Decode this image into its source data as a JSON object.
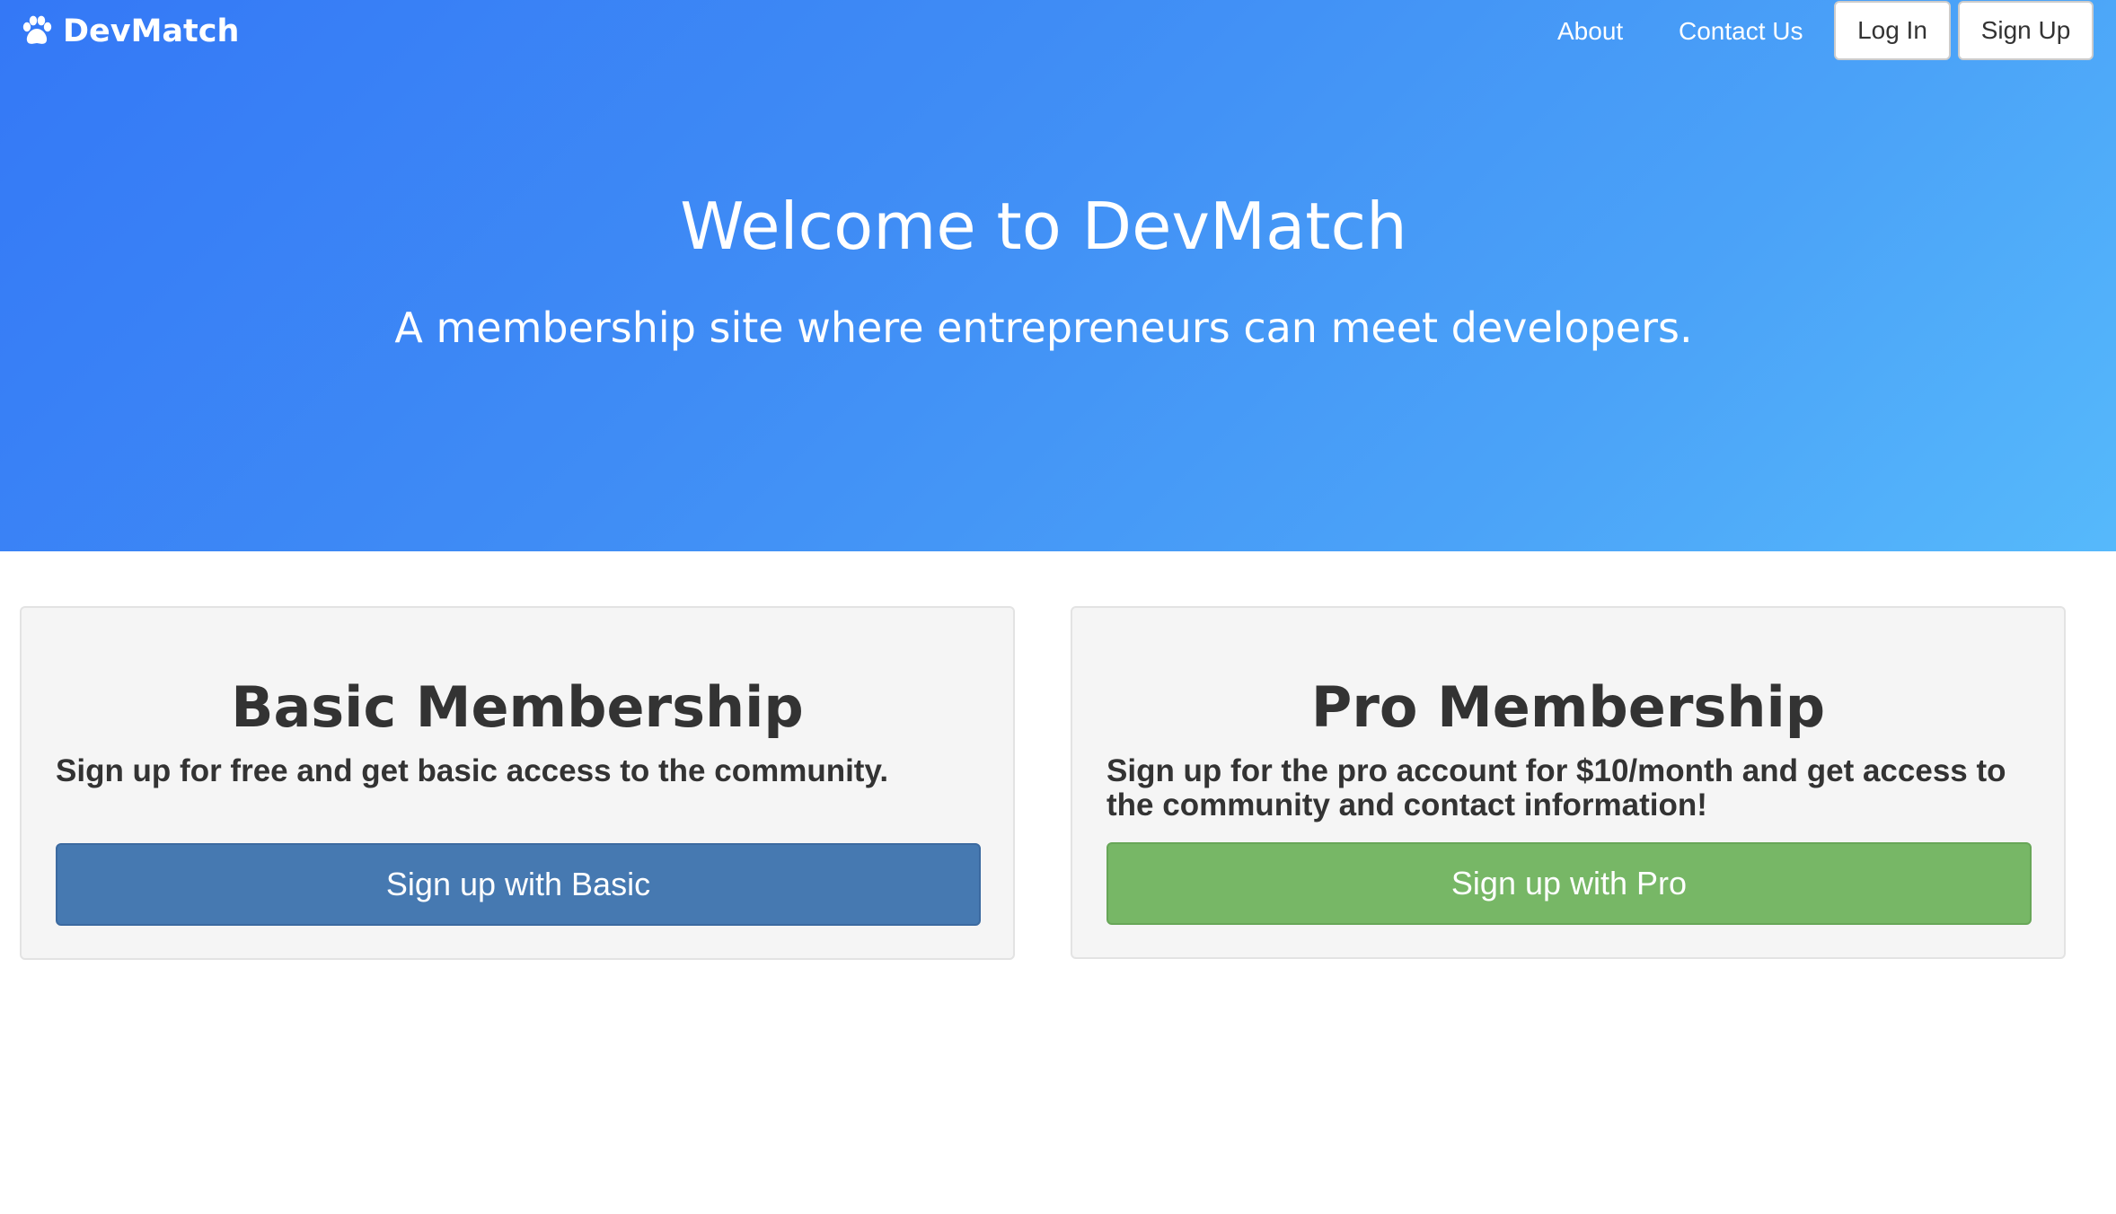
{
  "navbar": {
    "brand": {
      "icon": "paw-icon",
      "name": "DevMatch"
    },
    "links": {
      "about": "About",
      "contact": "Contact Us"
    },
    "buttons": {
      "login": "Log In",
      "signup": "Sign Up"
    }
  },
  "hero": {
    "title": "Welcome to DevMatch",
    "subtitle": "A membership site where entrepreneurs can meet developers.",
    "gradient": [
      "#3478f6",
      "#56b9fb"
    ]
  },
  "plans": {
    "basic": {
      "title": "Basic Membership",
      "description": "Sign up for free and get basic access to the community.",
      "button": "Sign up with Basic",
      "button_color": "#4679b1"
    },
    "pro": {
      "title": "Pro Membership",
      "description": "Sign up for the pro account for $10/month and get access to the community and contact information!",
      "button": "Sign up with Pro",
      "button_color": "#77b766"
    }
  }
}
